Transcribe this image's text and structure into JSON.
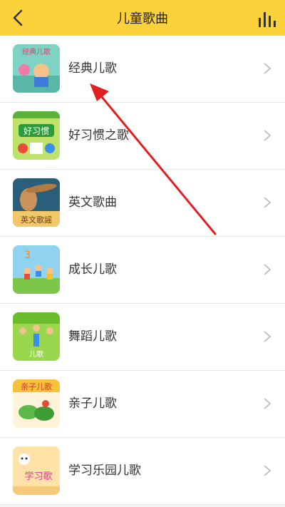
{
  "header": {
    "title": "儿童歌曲",
    "accent": "#fcd23a"
  },
  "list": {
    "items": [
      {
        "label": "经典儿歌",
        "thumb_text": "经典儿歌"
      },
      {
        "label": "好习惯之歌",
        "thumb_text": "好习惯"
      },
      {
        "label": "英文歌曲",
        "thumb_text": "英文歌謡"
      },
      {
        "label": "成长儿歌",
        "thumb_text": "3"
      },
      {
        "label": "舞蹈儿歌",
        "thumb_text": "儿歌"
      },
      {
        "label": "亲子儿歌",
        "thumb_text": "亲子儿歌"
      },
      {
        "label": "学习乐园儿歌",
        "thumb_text": "学习歌"
      }
    ]
  },
  "annotation": {
    "arrow_color": "#e02020"
  }
}
